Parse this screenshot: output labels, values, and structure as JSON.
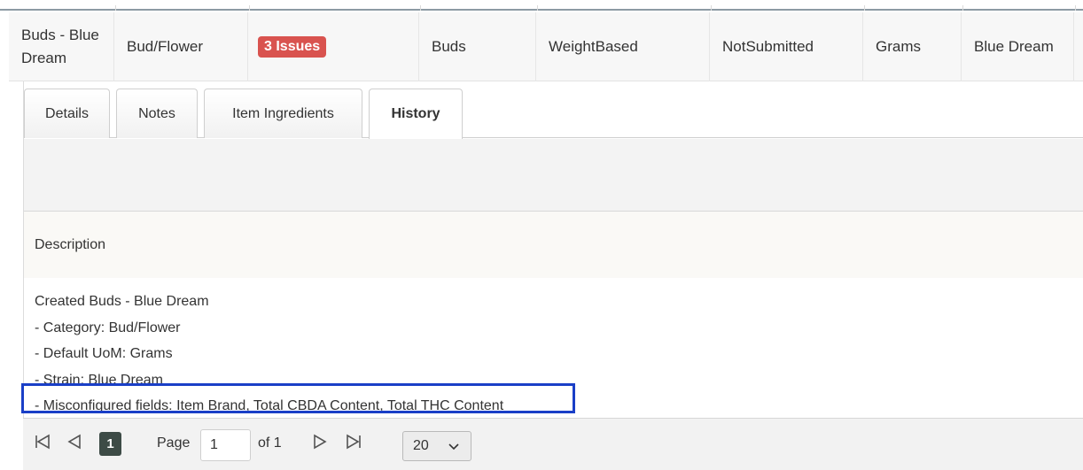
{
  "item_row": {
    "name": "Buds - Blue Dream",
    "category": "Bud/Flower",
    "issues_badge": "3 Issues",
    "item_type": "Buds",
    "quantity_type": "WeightBased",
    "status": "NotSubmitted",
    "uom": "Grams",
    "strain": "Blue Dream"
  },
  "tabs": [
    {
      "label": "Details"
    },
    {
      "label": "Notes"
    },
    {
      "label": "Item Ingredients"
    },
    {
      "label": "History",
      "active": true
    }
  ],
  "history": {
    "column_header": "Description",
    "lines": [
      "Created Buds - Blue Dream",
      "- Category: Bud/Flower",
      "- Default UoM: Grams",
      "- Strain: Blue Dream",
      "- Misconfigured fields: Item Brand, Total CBDA Content, Total THC Content"
    ],
    "highlight_color": "#1a3fc7"
  },
  "pager": {
    "first_icon": "first-page-icon",
    "prev_icon": "prev-page-icon",
    "next_icon": "next-page-icon",
    "last_icon": "last-page-icon",
    "current_page": "1",
    "page_label": "Page",
    "page_input_value": "1",
    "of_label": "of 1",
    "page_size": "20"
  },
  "colors": {
    "badge": "#d9534f",
    "pager_current": "#3d4b46"
  }
}
